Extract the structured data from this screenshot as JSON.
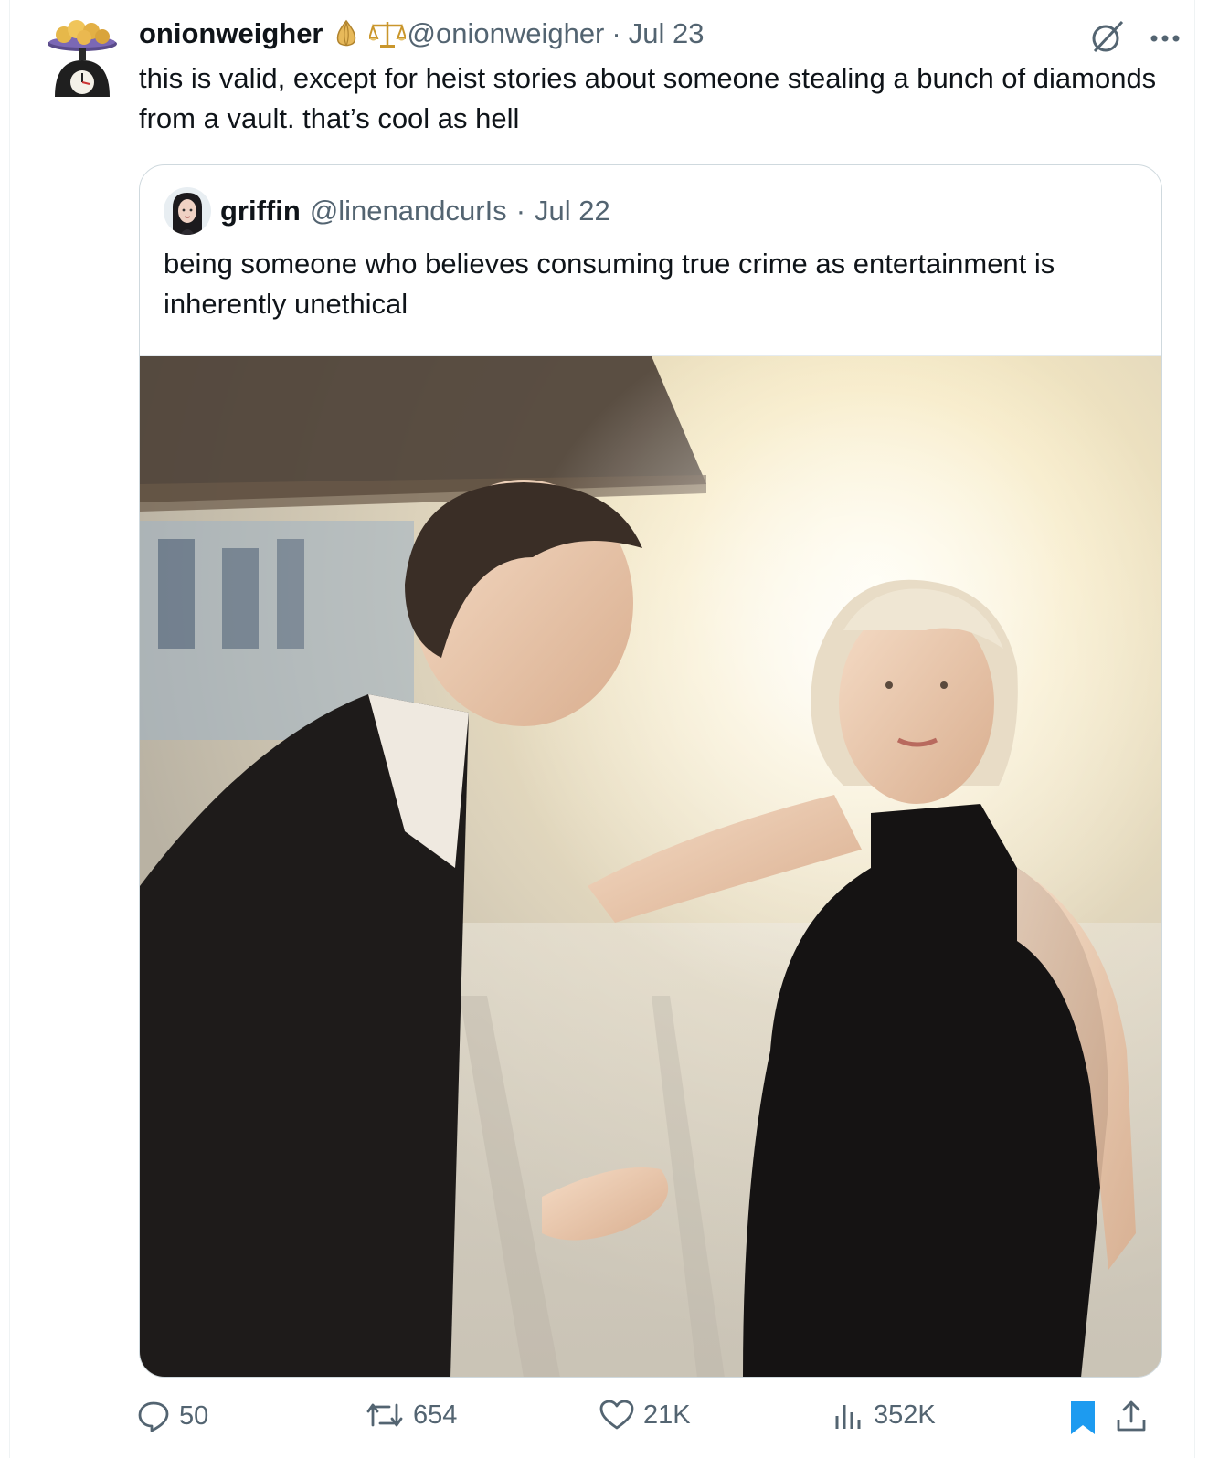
{
  "tweet": {
    "display_name": "onionweigher",
    "handle": "@onionweigher",
    "separator": "·",
    "date": "Jul 23",
    "text": "this is valid, except for heist stories about someone stealing a bunch of diamonds from a vault. that’s cool as hell",
    "avatar_icon": "onion-scale-icon",
    "badges": [
      "onion-icon",
      "balance-scale-icon"
    ]
  },
  "quoted": {
    "display_name": "griffin",
    "handle": "@linenandcurIs",
    "separator": "·",
    "date": "Jul 22",
    "text": "being someone who believes consuming true crime as entertainment is inherently unethical",
    "media_icon": "photo-man-woman-sunlight"
  },
  "actions": {
    "replies": "50",
    "retweets": "654",
    "likes": "21K",
    "views": "352K"
  },
  "colors": {
    "text": "#0f1419",
    "muted": "#536471",
    "border": "#cfd9de",
    "bookmark_blue": "#1d9bf0"
  }
}
